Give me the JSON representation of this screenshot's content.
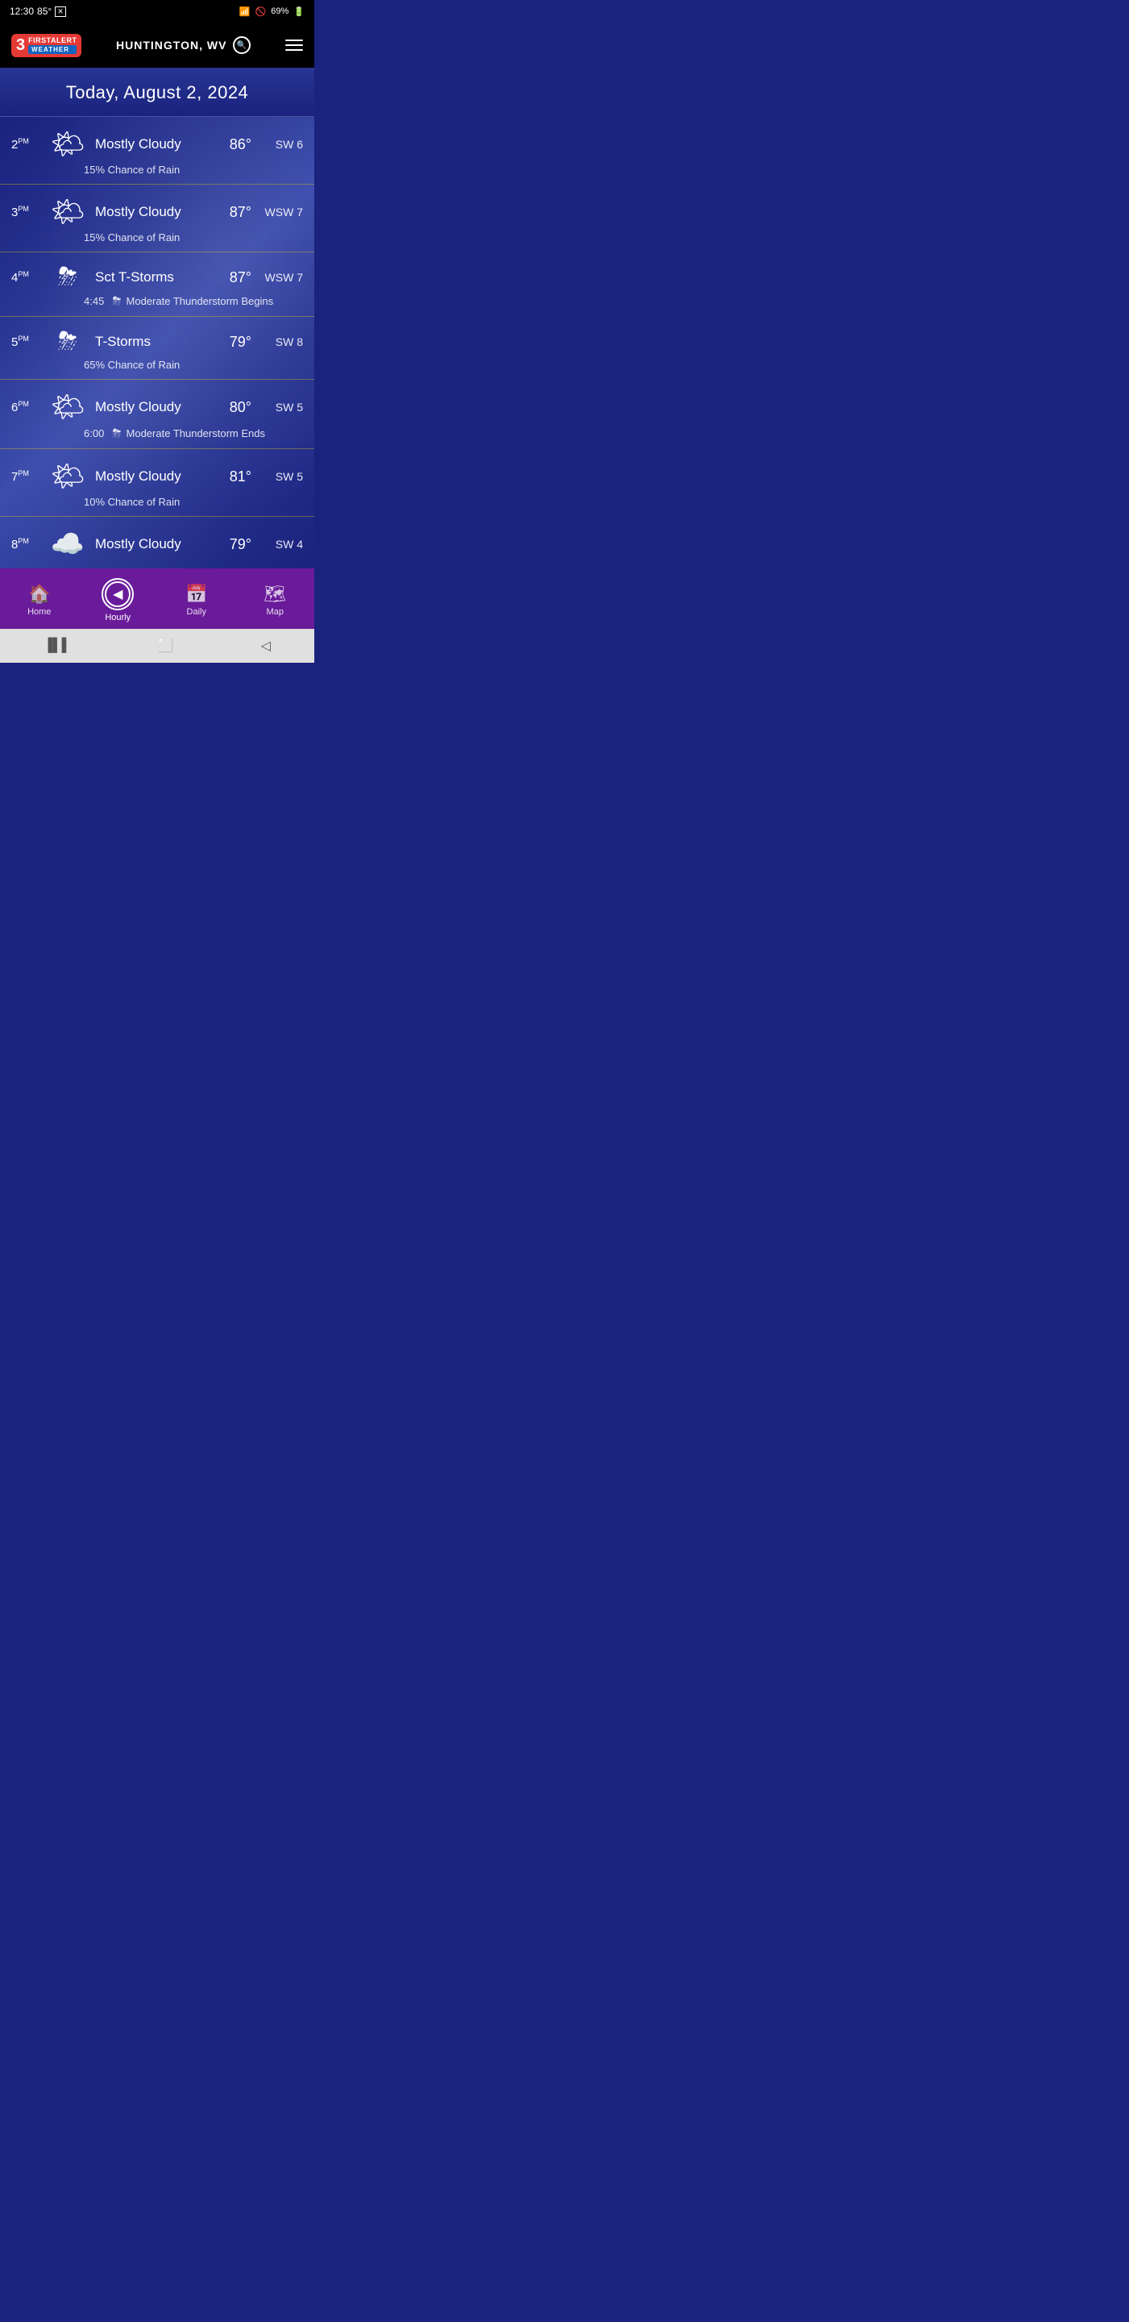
{
  "statusBar": {
    "time": "12:30",
    "temp": "85°",
    "battery": "69%"
  },
  "header": {
    "channel": "3",
    "brandLine1": "FIRSTALERT",
    "brandLine2": "WEATHER",
    "location": "HUNTINGTON, WV",
    "menuLabel": "menu"
  },
  "dateBanner": {
    "text": "Today, August 2, 2024"
  },
  "hourlyRows": [
    {
      "time": "2",
      "period": "PM",
      "icon": "mostly-cloudy-sun",
      "condition": "Mostly Cloudy",
      "temp": "86°",
      "wind": "SW 6",
      "detail": "15% Chance of Rain",
      "detailTime": "",
      "detailIcon": ""
    },
    {
      "time": "3",
      "period": "PM",
      "icon": "mostly-cloudy-sun",
      "condition": "Mostly Cloudy",
      "temp": "87°",
      "wind": "WSW 7",
      "detail": "15% Chance of Rain",
      "detailTime": "",
      "detailIcon": ""
    },
    {
      "time": "4",
      "period": "PM",
      "icon": "sct-tstorm",
      "condition": "Sct T-Storms",
      "temp": "87°",
      "wind": "WSW 7",
      "detail": "Moderate Thunderstorm Begins",
      "detailTime": "4:45",
      "detailIcon": "⛈"
    },
    {
      "time": "5",
      "period": "PM",
      "icon": "tstorm",
      "condition": "T-Storms",
      "temp": "79°",
      "wind": "SW 8",
      "detail": "65% Chance of Rain",
      "detailTime": "",
      "detailIcon": ""
    },
    {
      "time": "6",
      "period": "PM",
      "icon": "mostly-cloudy-sun",
      "condition": "Mostly Cloudy",
      "temp": "80°",
      "wind": "SW 5",
      "detail": "Moderate Thunderstorm Ends",
      "detailTime": "6:00",
      "detailIcon": "⛈"
    },
    {
      "time": "7",
      "period": "PM",
      "icon": "mostly-cloudy-sun",
      "condition": "Mostly Cloudy",
      "temp": "81°",
      "wind": "SW 5",
      "detail": "10% Chance of Rain",
      "detailTime": "",
      "detailIcon": ""
    },
    {
      "time": "8",
      "period": "PM",
      "icon": "mostly-cloudy-moon",
      "condition": "Mostly Cloudy",
      "temp": "79°",
      "wind": "SW 4",
      "detail": "",
      "detailTime": "",
      "detailIcon": ""
    }
  ],
  "bottomNav": {
    "items": [
      {
        "id": "home",
        "label": "Home",
        "icon": "🏠",
        "active": false
      },
      {
        "id": "hourly",
        "label": "Hourly",
        "icon": "◀",
        "active": true
      },
      {
        "id": "daily",
        "label": "Daily",
        "icon": "📅",
        "active": false
      },
      {
        "id": "map",
        "label": "Map",
        "icon": "🗺",
        "active": false
      }
    ]
  },
  "systemNav": {
    "back": "◁",
    "home": "⬜",
    "recent": "▐▌▌"
  }
}
